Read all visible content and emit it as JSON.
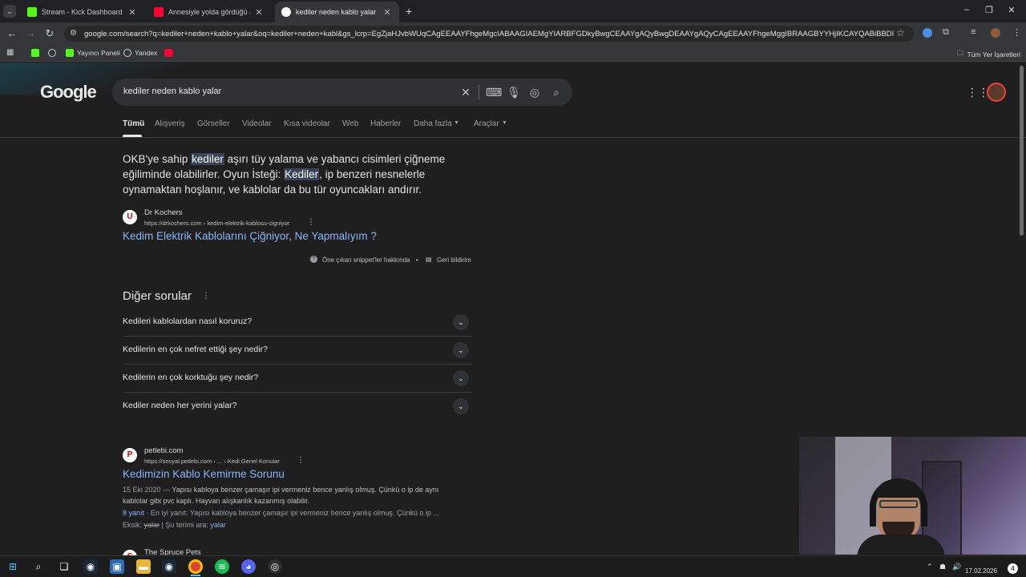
{
  "browser": {
    "tabs": [
      {
        "title": "Stream - Kick Dashboard",
        "active": false
      },
      {
        "title": "Annesiyle yolda gördüğü araba",
        "active": false
      },
      {
        "title": "kediler neden kablo yalar - Goo",
        "active": true
      }
    ],
    "new_tab": "+",
    "url": "google.com/search?q=kediler+neden+kablo+yalar&oq=kediler+neden+kabl&gs_lcrp=EgZjaHJvbWUqCAgEEAAYFhgeMgcIABAAGIAEMgYIARBFGDkyBwgCEAAYgAQyBwgDEAAYgAQyCAgEEAAYFhgeMggIBRAAGBYYHjIKCAYQABiBBDIKCAcQ..."
  },
  "bookmarks": {
    "items": [
      "Yayıncı Paneli",
      "Yandex"
    ],
    "all_bookmarks": "Tüm Yer İşaretleri"
  },
  "google": {
    "logo": "Google",
    "query": "kediler neden kablo yalar",
    "tabs": [
      "Tümü",
      "Alışveriş",
      "Görseller",
      "Videolar",
      "Kısa videolar",
      "Web",
      "Haberler",
      "Daha fazla",
      "Araçlar"
    ]
  },
  "snippet": {
    "p1": "OKB'ye sahip ",
    "h1": "kediler",
    "p2": " aşırı tüy yalama ve yabancı cisimleri çiğneme eğiliminde olabilirler. Oyun İsteği: ",
    "h2": "Kediler",
    "p3": ", ip benzeri nesnelerle oynamaktan hoşlanır, ve kablolar da bu tür oyuncakları andırır.",
    "source_name": "Dr Kochers",
    "source_url": "https://drkochers.com › kedim-elektrik-kablosu-cigniyor",
    "title": "Kedim Elektrik Kablolarını Çiğniyor, Ne Yapmalıyım ?",
    "about": "Öne çıkan snippet'ler hakkında",
    "feedback": "Geri bildirim"
  },
  "paa": {
    "title": "Diğer sorular",
    "questions": [
      "Kedileri kablolardan nasıl koruruz?",
      "Kedilerin en çok nefret ettiği şey nedir?",
      "Kedilerin en çok korktuğu şey nedir?",
      "Kediler neden her yerini yalar?"
    ]
  },
  "result2": {
    "source_name": "petlebi.com",
    "source_url": "https://sosyal.petlebi.com › ... › Kedi Genel Konular",
    "title": "Kedimizin Kablo Kemirme Sorunu",
    "date": "15 Eki 2020 —",
    "desc1": " Yapısı kabloya benzer çamaşır ipi vermeniz bence yanlış olmuş. Çünkü o ip de aynı",
    "desc2": "kablolar gibi pvc kaplı. Hayvan alışkanlık kazanmış olabilir.",
    "answers": "8 yanıt",
    "best_answer": " · En iyi yanıt: Yapısı kabloya benzer çamaşır ipi vermeniz bence yanlış olmuş. Çünkü o ip ...",
    "missing_label": "Eksik: ",
    "missing_word": "yalar",
    "must_include": " | Şu terimi ara: ",
    "must_word": "yalar"
  },
  "result3": {
    "source_name": "The Spruce Pets"
  },
  "taskbar": {
    "date": "17.02.2026",
    "notif": "4"
  }
}
